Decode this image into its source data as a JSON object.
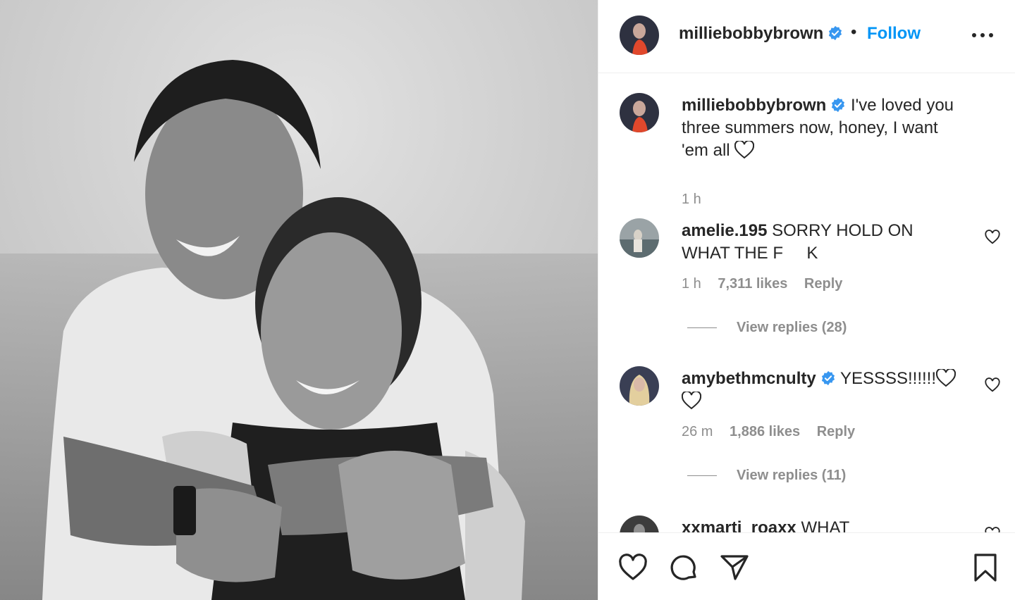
{
  "post": {
    "username": "milliebobbybrown",
    "follow_label": "Follow",
    "separator": "•"
  },
  "caption": {
    "username": "milliebobbybrown",
    "text": "I've loved you three summers now, honey, I want 'em all",
    "time": "1 h"
  },
  "comments": [
    {
      "username": "amelie.195",
      "text": "SORRY HOLD ON WHAT THE F     K",
      "time": "1 h",
      "likes": "7,311 likes",
      "reply": "Reply",
      "view_replies": "View replies (28)",
      "verified": false
    },
    {
      "username": "amybethmcnulty",
      "text": "YESSSS!!!!!!",
      "time": "26 m",
      "likes": "1,886 likes",
      "reply": "Reply",
      "view_replies": "View replies (11)",
      "verified": true
    },
    {
      "username": "xxmarti_roaxx",
      "text": "WHAT",
      "verified": false
    }
  ],
  "colors": {
    "link_blue": "#0095f6",
    "verified_blue": "#3897f0",
    "text_primary": "#262626",
    "text_secondary": "#8e8e8e"
  },
  "icons": {
    "actions": [
      "heart-icon",
      "comment-icon",
      "share-icon",
      "bookmark-icon"
    ]
  }
}
